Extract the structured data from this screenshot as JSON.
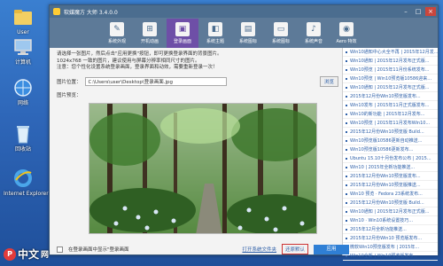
{
  "desktop": {
    "icons": [
      {
        "label": "User"
      },
      {
        "label": "计算机"
      },
      {
        "label": "网络"
      },
      {
        "label": "回收站"
      },
      {
        "label": "Internet Explorer"
      }
    ]
  },
  "window": {
    "title": "软媒魔方 大师 3.4.0.0",
    "controls": [
      "–",
      "□",
      "×"
    ]
  },
  "toolbar": {
    "tools": [
      {
        "label": "系统外观",
        "icon": "brush-icon"
      },
      {
        "label": "开机动画",
        "icon": "windows-logo-icon"
      },
      {
        "label": "登录画面",
        "icon": "login-screen-icon",
        "active": true
      },
      {
        "label": "系统主题",
        "icon": "theme-icon"
      },
      {
        "label": "系统图标",
        "icon": "folder-icon"
      },
      {
        "label": "系统图标",
        "icon": "desktop-icon"
      },
      {
        "label": "系统声音",
        "icon": "sound-icon"
      },
      {
        "label": "Aero 特效",
        "icon": "aero-icon"
      }
    ]
  },
  "main": {
    "intro_lines": [
      "请选择一张图片，然后点击\"应用更换\"按钮，即可更换登录界面的背景图片。",
      "1024x768 一致的图片，建议使用与屏幕分辨率相同尺寸的图片。",
      "注意：您个性化设置系统登录画面，登录界面和动效，需要重新登录一次！"
    ],
    "path_label": "图片位置：",
    "path_value": "C:\\Users\\user\\Desktop\\登录画面.jpg",
    "browse_label": "浏览",
    "preview_label": "图片预览：",
    "checkbox_label": "在登录画面中显示\"登录画面",
    "link_label": "打开系统文件夹",
    "restore_label": "还原默认",
    "apply_label": "应用"
  },
  "news": [
    "Win10通知中心大全不再 | 2015年12月发...",
    "Win10通知 | 2015年12月发布正式版...",
    "Win10预览 | 2015年11月份系统发布...",
    "Win10预览 | Win10预览版10586迎来...",
    "Win10通知 | 2015年12月发布正式版...",
    "2015年12月份Win10预览版发布...",
    "Win10发布 | 2015年11月正式版发布...",
    "Win10的新功能 | 2015年12月发布...",
    "Win10预览 | 2015年11月发布Win10...",
    "2015年12月份Win10预览版 Build...",
    "Win10预览版10586更新自动推送...",
    "Win10预览版10586更新发布...",
    "Ubuntu 15.10十月份发布公布 | 2015...",
    "Win10 | 2015年全新功能推送...",
    "2015年12月份Win10预览版发布...",
    "2015年12月份Win10预览版推送...",
    "Win10 预览 · Fedora 23系统发布...",
    "2015年12月份Win10预览版 Build...",
    "Win10通知 | 2015年12月发布正式版...",
    "Win10 · Win10系统设置技巧...",
    "2015年12月全新功能推送...",
    "2015年12月份Win10 预览版发布...",
    "微软Win10预览版发布 | 2015年...",
    "Win10全新 | Win10预览版发布..."
  ],
  "watermark": {
    "logo": "P",
    "text1": "中文",
    "text2": "网"
  }
}
